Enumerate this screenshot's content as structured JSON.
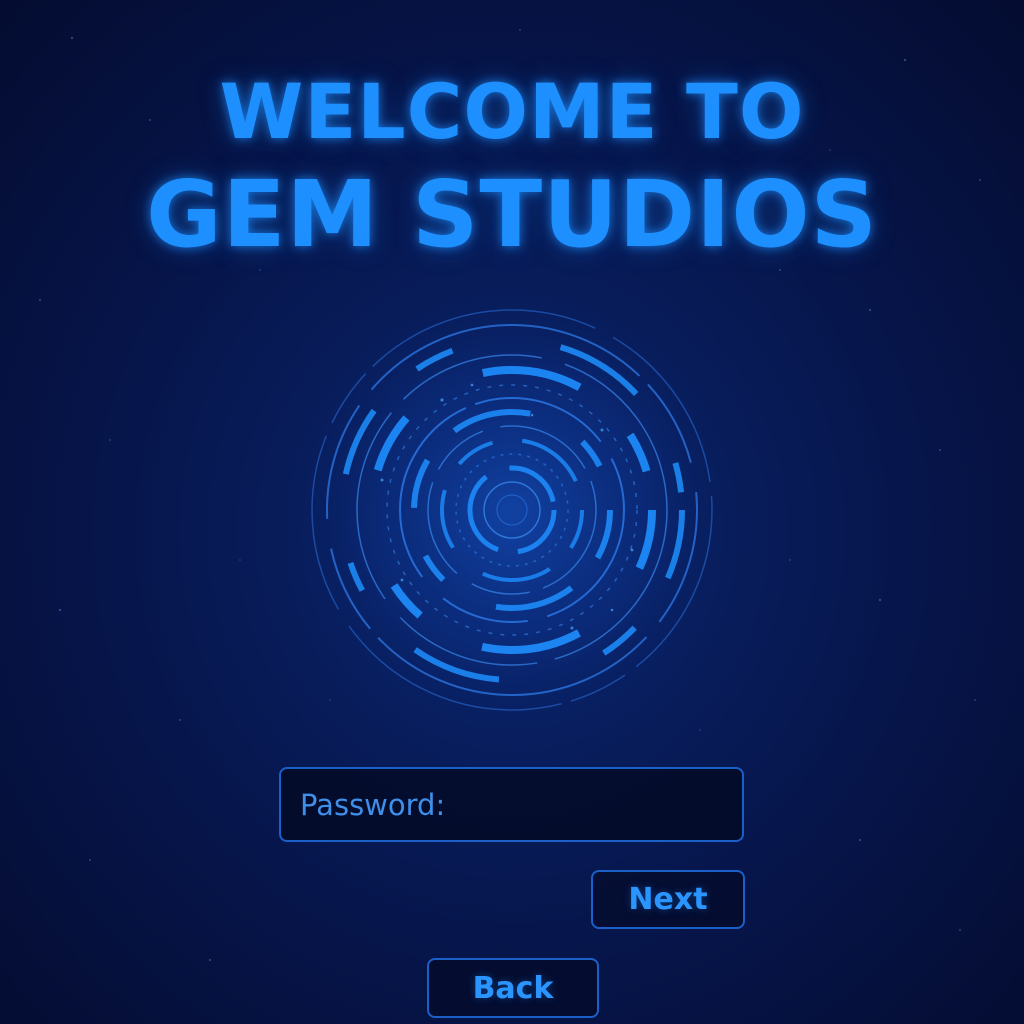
{
  "header": {
    "line1": "WELCOME TO",
    "line2": "GEM STUDIOS"
  },
  "emblem": {
    "icon": "concentric-rings-logo-icon"
  },
  "form": {
    "password_placeholder": "Password:",
    "password_value": ""
  },
  "buttons": {
    "next_label": "Next",
    "back_label": "Back"
  },
  "colors": {
    "accent": "#1e8fff",
    "background": "#061448",
    "border": "#1b5fc8"
  }
}
